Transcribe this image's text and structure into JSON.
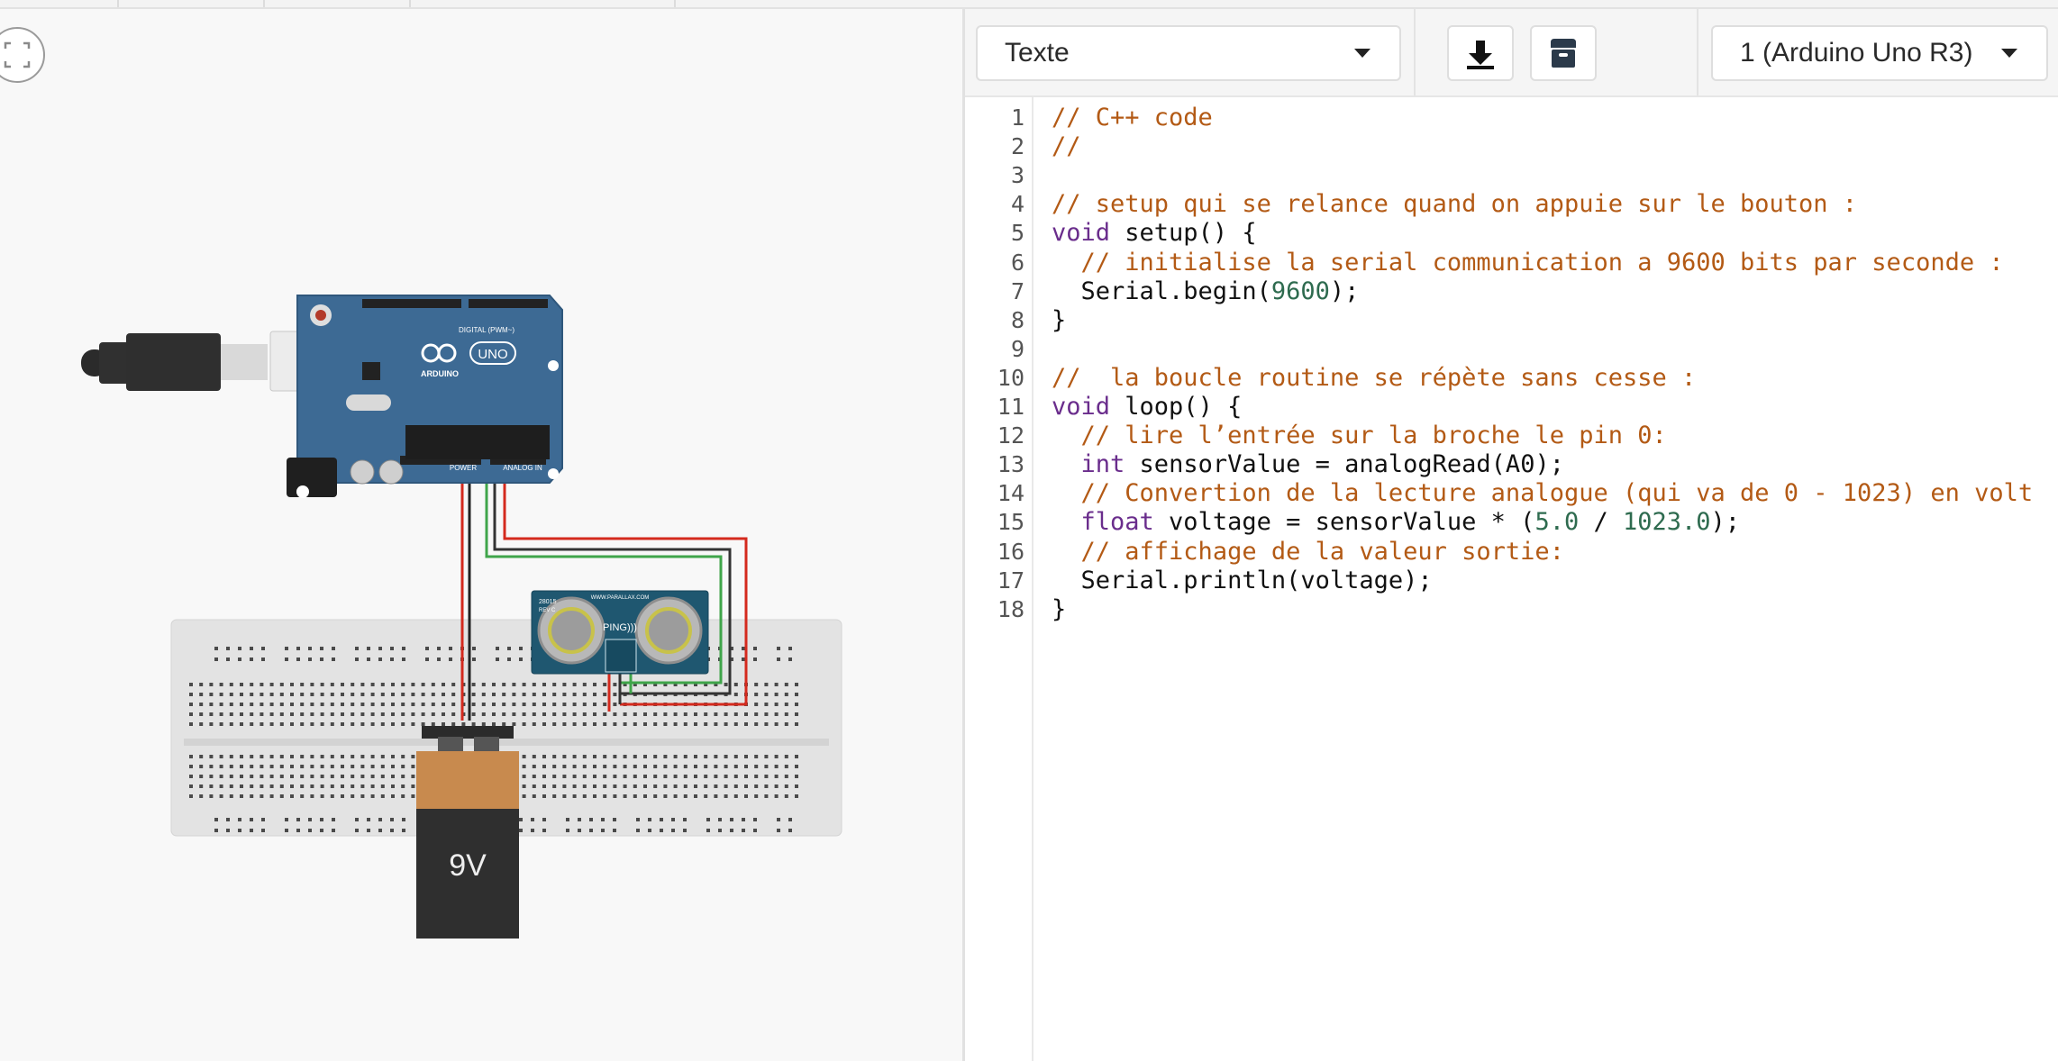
{
  "canvas": {
    "battery_label": "9V",
    "board_labels": {
      "uno": "UNO",
      "arduino": "ARDUINO",
      "digital": "DIGITAL (PWM~)",
      "power": "POWER",
      "analog_in": "ANALOG IN"
    },
    "sensor_labels": {
      "model": "28015",
      "rev": "REV C",
      "brand": "WWW.PARALLAX.COM",
      "name": "PING)))"
    }
  },
  "toolbar": {
    "mode_label": "Texte",
    "download_icon": "download-icon",
    "library_icon": "archive-icon",
    "device_label": "1 (Arduino Uno R3)"
  },
  "editor": {
    "colors": {
      "comment": "#b35a15",
      "keyword": "#6a2d8c",
      "number": "#2e6b4f"
    },
    "line_numbers": [
      "1",
      "2",
      "3",
      "4",
      "5",
      "6",
      "7",
      "8",
      "9",
      "10",
      "11",
      "12",
      "13",
      "14",
      "15",
      "16",
      "17",
      "18"
    ],
    "lines": [
      [
        {
          "t": "comment",
          "v": "// C++ code"
        }
      ],
      [
        {
          "t": "comment",
          "v": "//"
        }
      ],
      [],
      [
        {
          "t": "comment",
          "v": "// setup qui se relance quand on appuie sur le bouton :"
        }
      ],
      [
        {
          "t": "keyword",
          "v": "void"
        },
        {
          "t": "plain",
          "v": " setup() {"
        }
      ],
      [
        {
          "t": "plain",
          "v": "  "
        },
        {
          "t": "comment",
          "v": "// initialise la serial communication a 9600 bits par seconde :"
        }
      ],
      [
        {
          "t": "plain",
          "v": "  Serial.begin("
        },
        {
          "t": "number",
          "v": "9600"
        },
        {
          "t": "plain",
          "v": ");"
        }
      ],
      [
        {
          "t": "plain",
          "v": "}"
        }
      ],
      [],
      [
        {
          "t": "comment",
          "v": "//  la boucle routine se répète sans cesse :"
        }
      ],
      [
        {
          "t": "keyword",
          "v": "void"
        },
        {
          "t": "plain",
          "v": " loop() {"
        }
      ],
      [
        {
          "t": "plain",
          "v": "  "
        },
        {
          "t": "comment",
          "v": "// lire l’entrée sur la broche le pin 0:"
        }
      ],
      [
        {
          "t": "plain",
          "v": "  "
        },
        {
          "t": "keyword",
          "v": "int"
        },
        {
          "t": "plain",
          "v": " sensorValue = analogRead(A0);"
        }
      ],
      [
        {
          "t": "plain",
          "v": "  "
        },
        {
          "t": "comment",
          "v": "// Convertion de la lecture analogue (qui va de 0 - 1023) en volt"
        }
      ],
      [
        {
          "t": "plain",
          "v": "  "
        },
        {
          "t": "keyword",
          "v": "float"
        },
        {
          "t": "plain",
          "v": " voltage = sensorValue * ("
        },
        {
          "t": "number",
          "v": "5.0"
        },
        {
          "t": "plain",
          "v": " / "
        },
        {
          "t": "number",
          "v": "1023.0"
        },
        {
          "t": "plain",
          "v": ");"
        }
      ],
      [
        {
          "t": "plain",
          "v": "  "
        },
        {
          "t": "comment",
          "v": "// affichage de la valeur sortie:"
        }
      ],
      [
        {
          "t": "plain",
          "v": "  Serial.println(voltage);"
        }
      ],
      [
        {
          "t": "plain",
          "v": "}"
        }
      ]
    ]
  }
}
